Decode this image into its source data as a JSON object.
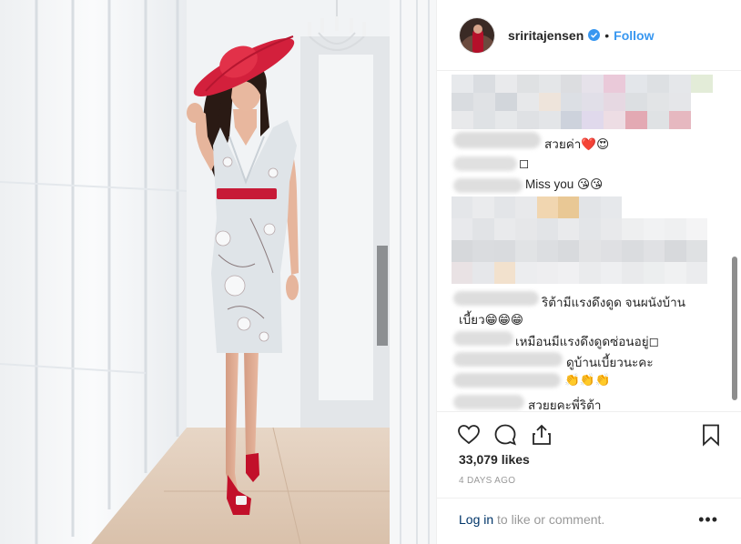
{
  "post": {
    "username": "sriritajensen",
    "follow_label": "Follow",
    "separator": "•",
    "likes": "33,079 likes",
    "date": "4 DAYS AGO",
    "login_link": "Log in",
    "login_rest": " to like or comment.",
    "more_label": "•••"
  },
  "comments": [
    {
      "text": "สวยค่า❤️😍"
    },
    {
      "text": "◻"
    },
    {
      "text": "Miss you 😘😘"
    },
    {
      "text": "ริต้ามีแรงดึงดูด จนผนังบ้าน"
    },
    {
      "text": "เบี้ยว😁😁😁"
    },
    {
      "text": "เหมือนมีแรงดึงดูดซ่อนอยู่◻"
    },
    {
      "text": "ดูบ้านเบี้ยวนะคะ"
    },
    {
      "text": "👏👏👏"
    },
    {
      "text": "สวยยคะพี่ริต้า"
    }
  ],
  "colors": {
    "link_blue": "#3897f0",
    "verified_blue": "#3897f0",
    "hat_red": "#d3203c",
    "dress": "#dfe4e8"
  },
  "icons": [
    "heart-icon",
    "comment-icon",
    "share-icon",
    "bookmark-icon",
    "verified-badge-icon",
    "more-options-icon"
  ]
}
